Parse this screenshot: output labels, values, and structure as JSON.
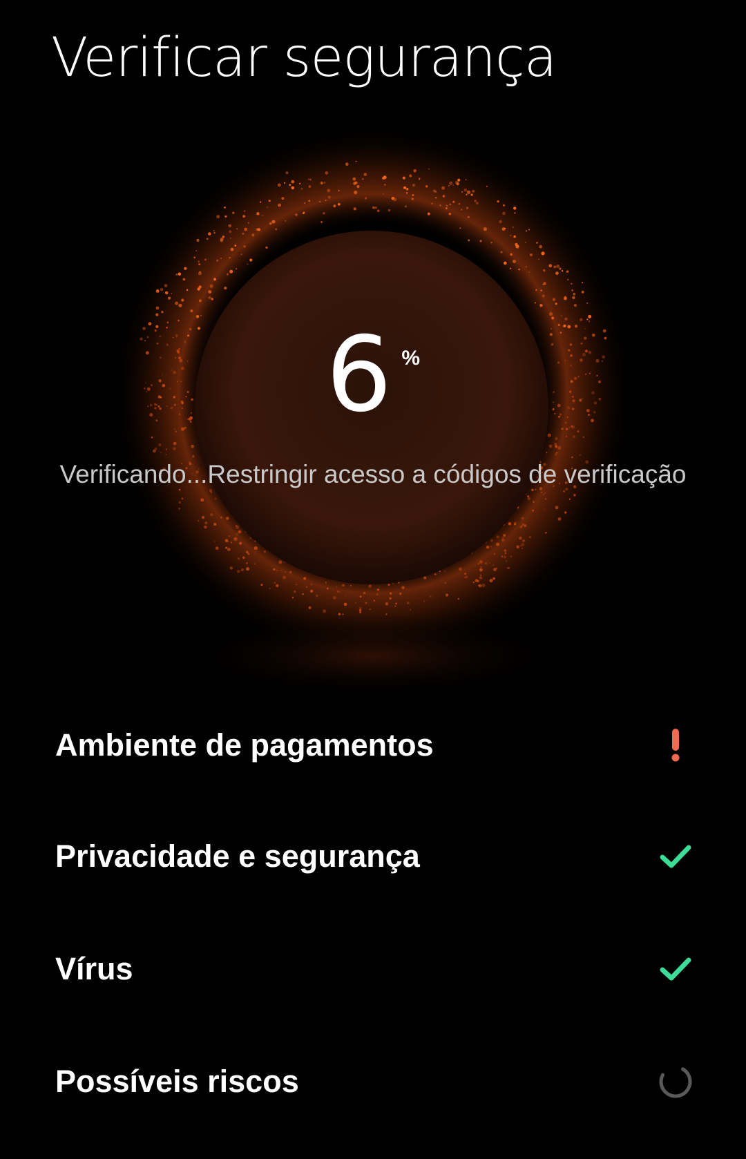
{
  "header": {
    "title": "Verificar segurança"
  },
  "scan": {
    "progress_value": "6",
    "progress_unit": "%",
    "progress_percent": 6,
    "status_text": "Verificando...Restringir acesso a códigos de verificação",
    "accent_color": "#e0531a"
  },
  "checks": [
    {
      "label": "Ambiente de pagamentos",
      "status": "warning",
      "icon": "exclamation-icon",
      "color": "#f26a4f"
    },
    {
      "label": "Privacidade e segurança",
      "status": "passed",
      "icon": "check-icon",
      "color": "#3ddc97"
    },
    {
      "label": "Vírus",
      "status": "passed",
      "icon": "check-icon",
      "color": "#3ddc97"
    },
    {
      "label": "Possíveis riscos",
      "status": "scanning",
      "icon": "spinner-icon",
      "color": "#5a5a5a"
    }
  ]
}
